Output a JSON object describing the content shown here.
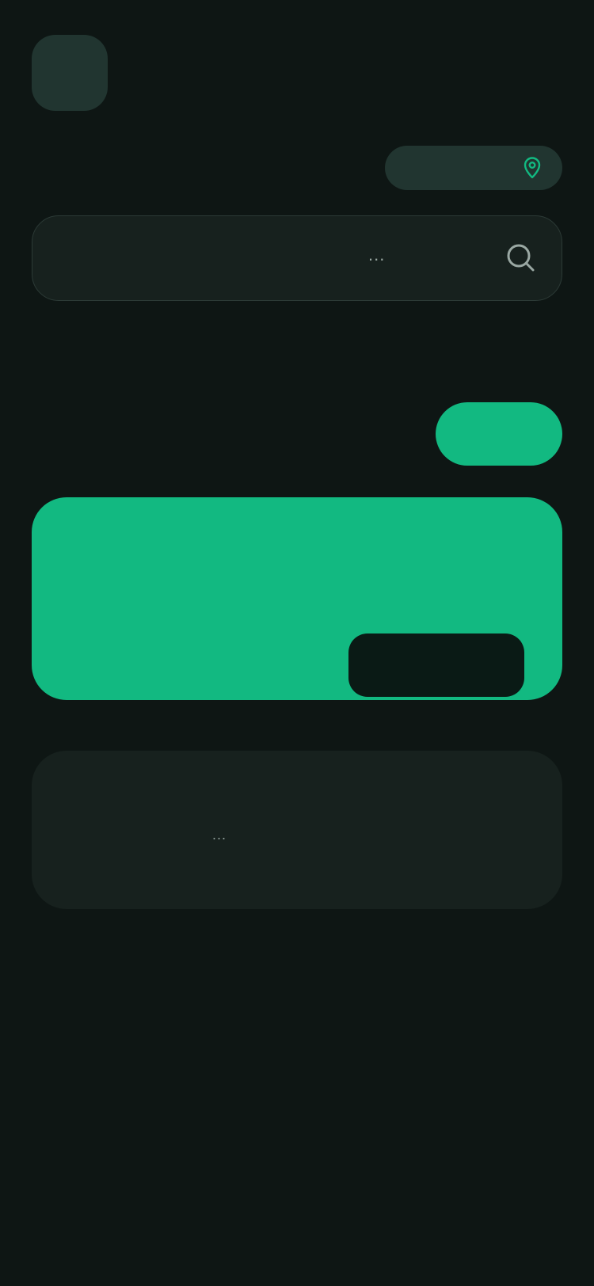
{
  "header": {
    "avatar_icon": "avatar",
    "location": {
      "label": "",
      "icon": "map-pin-icon",
      "icon_color": "#12b981"
    }
  },
  "search": {
    "placeholder": "...",
    "value": "",
    "icon": "search-icon"
  },
  "actions": {
    "pill_button_label": ""
  },
  "hero": {
    "title": "",
    "action_label": "",
    "color": "#12b981"
  },
  "info": {
    "text": "..."
  },
  "colors": {
    "background": "#0e1614",
    "accent": "#12b981",
    "surface": "#17211e",
    "surface_alt": "#213530"
  }
}
